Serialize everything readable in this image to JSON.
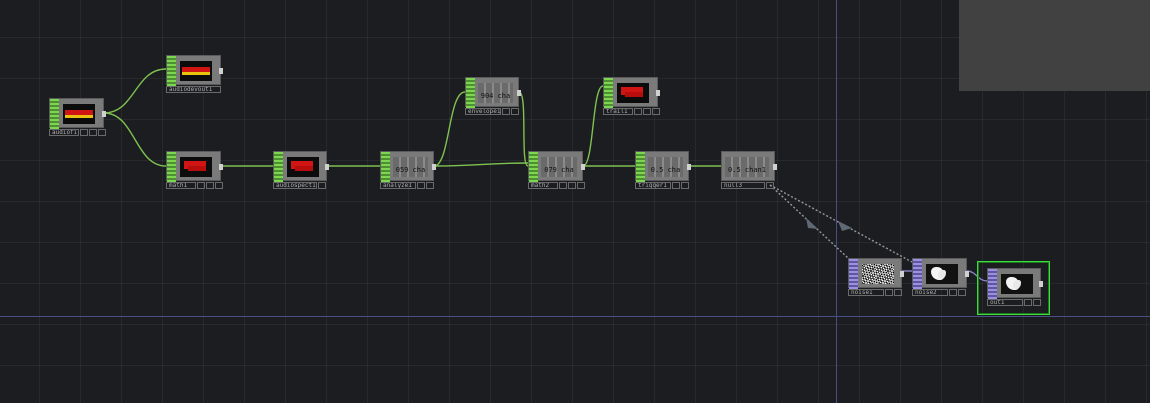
{
  "nodes": [
    {
      "id": "audiofilein1",
      "label": "audiofilein1",
      "family": "chop",
      "preview": "audio"
    },
    {
      "id": "audiodevout1",
      "label": "audiodevout1",
      "family": "chop",
      "preview": "red"
    },
    {
      "id": "math1",
      "label": "math1",
      "family": "chop",
      "preview": "red"
    },
    {
      "id": "audiospect1",
      "label": "audiospect1",
      "family": "chop",
      "preview": "red"
    },
    {
      "id": "analyze1",
      "label": "analyze1",
      "family": "chop",
      "chan_text": "059 cha"
    },
    {
      "id": "envelope1",
      "label": "envelope1",
      "family": "chop",
      "chan_text": "904 cha"
    },
    {
      "id": "math2",
      "label": "math2",
      "family": "chop",
      "chan_text": "079 cha"
    },
    {
      "id": "trail1",
      "label": "trail1",
      "family": "chop",
      "preview": "red"
    },
    {
      "id": "trigger1",
      "label": "trigger1",
      "family": "chop",
      "chan_text": "0.5 cha"
    },
    {
      "id": "null3",
      "label": "null3",
      "family": "chop",
      "chan_text": "0.5 chan1"
    },
    {
      "id": "noise1",
      "label": "noise1",
      "family": "top",
      "preview": "noise"
    },
    {
      "id": "noise2",
      "label": "noise2",
      "family": "top",
      "preview": "blob"
    },
    {
      "id": "out1",
      "label": "out1",
      "family": "top",
      "preview": "blob",
      "selected": true
    }
  ],
  "colors": {
    "background": "#1c1d20",
    "chop_wire": "#7ec24f",
    "top_wire": "#8a85c8",
    "export_wire": "#8f9aa6",
    "chop_inlet": "#6fbf45",
    "top_inlet": "#8a7fd0",
    "selection": "#3ddc3d",
    "axis": "#4b4e86",
    "overlay_panel": "#414141"
  }
}
